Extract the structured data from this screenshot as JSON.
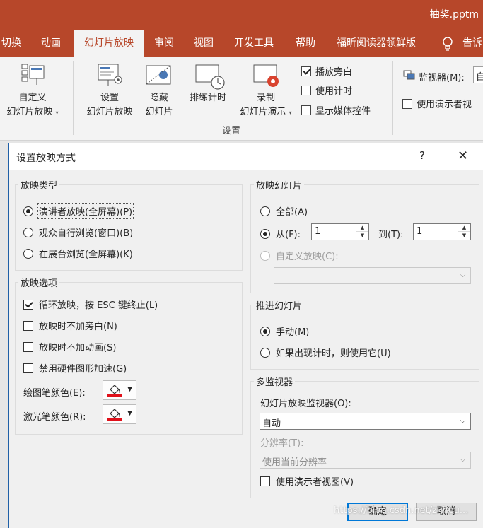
{
  "window": {
    "doc_title": "抽奖.pptm"
  },
  "ribbon": {
    "tabs": [
      "切换",
      "动画",
      "幻灯片放映",
      "审阅",
      "视图",
      "开发工具",
      "帮助",
      "福昕阅读器领鲜版",
      "告诉"
    ],
    "active_tab": "幻灯片放映",
    "custom_show": {
      "line1": "自定义",
      "line2": "幻灯片放映"
    },
    "setup_show": {
      "line1": "设置",
      "line2": "幻灯片放映"
    },
    "hide_slide": {
      "line1": "隐藏",
      "line2": "幻灯片"
    },
    "rehearse": {
      "line1": "排练计时"
    },
    "record": {
      "line1": "录制",
      "line2": "幻灯片演示"
    },
    "checkboxes": [
      {
        "label": "播放旁白",
        "checked": true
      },
      {
        "label": "使用计时",
        "checked": false
      },
      {
        "label": "显示媒体控件",
        "checked": false
      }
    ],
    "group_label": "设置",
    "monitor_label": "监视器(M):",
    "monitor_value": "自",
    "presenter_view_label": "使用演示者视"
  },
  "dialog": {
    "title": "设置放映方式",
    "help": "?",
    "close": "✕",
    "show_type": {
      "title": "放映类型",
      "options": [
        {
          "label": "演讲者放映(全屏幕)(P)",
          "selected": true
        },
        {
          "label": "观众自行浏览(窗口)(B)",
          "selected": false
        },
        {
          "label": "在展台浏览(全屏幕)(K)",
          "selected": false
        }
      ]
    },
    "show_options": {
      "title": "放映选项",
      "checks": [
        {
          "label": "循环放映，按 ESC 键终止(L)",
          "checked": true
        },
        {
          "label": "放映时不加旁白(N)",
          "checked": false
        },
        {
          "label": "放映时不加动画(S)",
          "checked": false
        },
        {
          "label": "禁用硬件图形加速(G)",
          "checked": false
        }
      ],
      "pen_color_label": "绘图笔颜色(E):",
      "laser_color_label": "激光笔颜色(R):",
      "pen_color": "#e0101a",
      "laser_color": "#e0101a"
    },
    "show_slides": {
      "title": "放映幻灯片",
      "all_label": "全部(A)",
      "all_selected": false,
      "from_label": "从(F):",
      "from_selected": true,
      "from_value": "1",
      "to_label": "到(T):",
      "to_value": "1",
      "custom_label": "自定义放映(C):",
      "custom_value": ""
    },
    "advance": {
      "title": "推进幻灯片",
      "options": [
        {
          "label": "手动(M)",
          "selected": true
        },
        {
          "label": "如果出现计时，则使用它(U)",
          "selected": false
        }
      ]
    },
    "multi_monitor": {
      "title": "多监视器",
      "monitor_label": "幻灯片放映监视器(O):",
      "monitor_value": "自动",
      "resolution_label": "分辨率(T):",
      "resolution_value": "使用当前分辨率",
      "presenter_view_label": "使用演示者视图(V)",
      "presenter_view_checked": false
    },
    "ok_label": "确定",
    "cancel_label": "取消"
  },
  "watermark": "https://blog.csdn.net/zkheu..."
}
